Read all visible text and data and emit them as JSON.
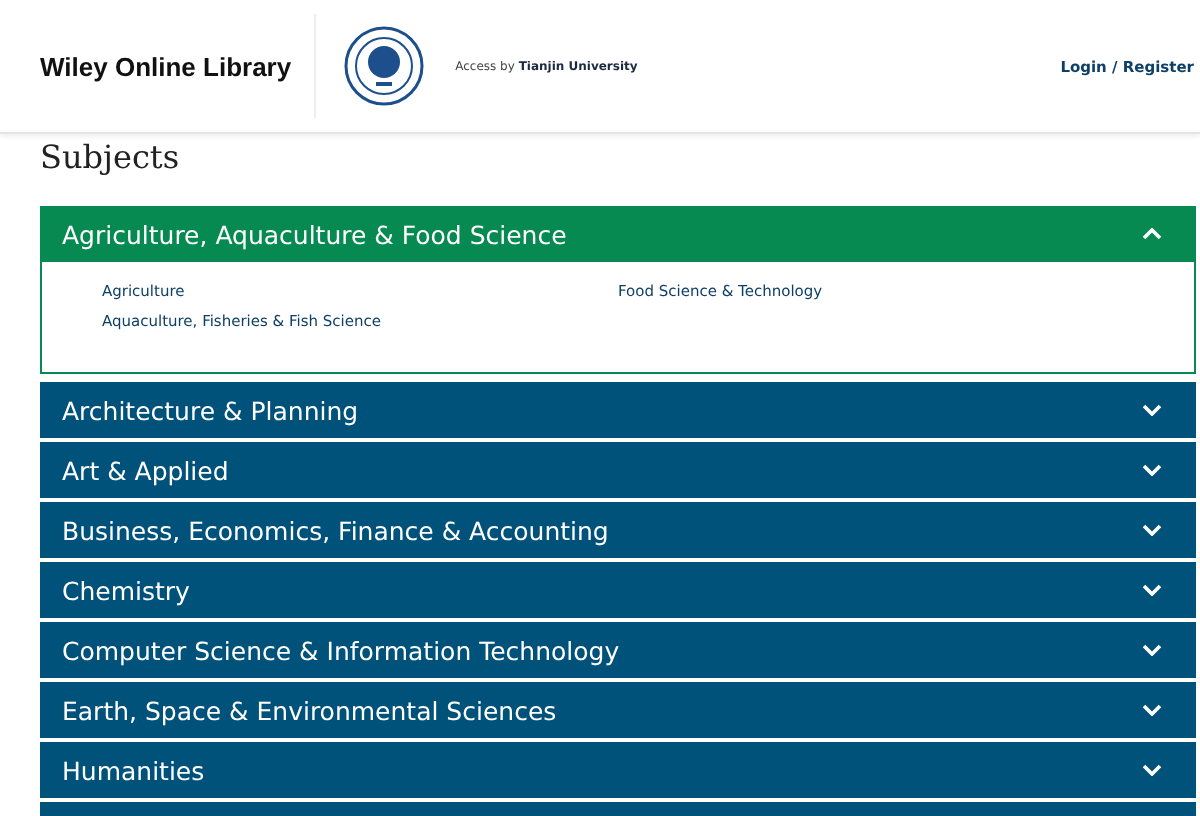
{
  "header": {
    "brand": "Wiley Online Library",
    "access_label": "Access by",
    "institution": "Tianjin University",
    "login": "Login / Register"
  },
  "page_title": "Subjects",
  "sections": [
    {
      "title": "Agriculture, Aquaculture & Food Science",
      "expanded": true,
      "children": [
        {
          "label": "Agriculture"
        },
        {
          "label": "Aquaculture, Fisheries & Fish Science"
        },
        {
          "label": "Food Science & Technology"
        }
      ]
    },
    {
      "title": "Architecture & Planning",
      "expanded": false
    },
    {
      "title": "Art & Applied",
      "expanded": false
    },
    {
      "title": "Business, Economics, Finance & Accounting",
      "expanded": false
    },
    {
      "title": "Chemistry",
      "expanded": false
    },
    {
      "title": "Computer Science & Information Technology",
      "expanded": false
    },
    {
      "title": "Earth, Space & Environmental Sciences",
      "expanded": false
    },
    {
      "title": "Humanities",
      "expanded": false
    }
  ]
}
